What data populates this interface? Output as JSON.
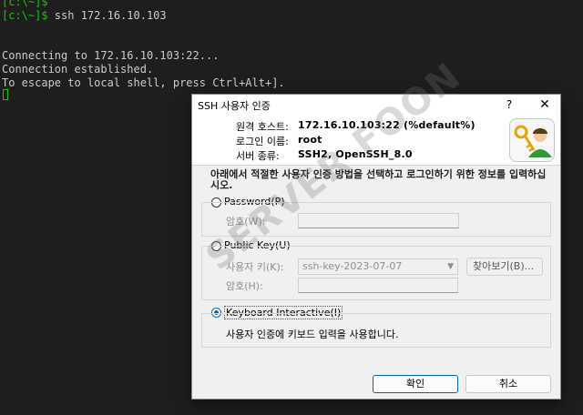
{
  "terminal": {
    "lines": [
      "[c:\\~]$",
      "[c:\\~]$ ssh 172.16.10.103",
      "Connecting to 172.16.10.103:22...",
      "Connection established.",
      "To escape to local shell, press Ctrl+Alt+]."
    ]
  },
  "dialog": {
    "title": "SSH 사용자 인증",
    "help_label": "?",
    "close_label": "✕",
    "info": {
      "host_label": "원격 호스트:",
      "host_value": "172.16.10.103:22 (%default%)",
      "login_label": "로그인 이름:",
      "login_value": "root",
      "server_label": "서버 종류:",
      "server_value": "SSH2, OpenSSH_8.0"
    },
    "description": "아래에서 적절한 사용자 인증 방법을 선택하고 로그인하기 위한 정보를 입력하십시오.",
    "password": {
      "label": "Password(P)",
      "field_label": "암호(W):",
      "value": ""
    },
    "public_key": {
      "label": "Public Key(U)",
      "user_key_label": "사용자 키(K):",
      "user_key_value": "ssh-key-2023-07-07",
      "browse_label": "찾아보기(B)...",
      "passphrase_label": "암호(H):"
    },
    "keyboard": {
      "label": "Keyboard Interactive(I)",
      "help_text": "사용자 인증에 키보드 입력을 사용합니다.",
      "selected": true
    },
    "ok_label": "확인",
    "cancel_label": "취소"
  },
  "watermark": "SERVER FOON",
  "colors": {
    "terminal_bg": "#1e1e1e",
    "prompt_green": "#16c60c",
    "accent": "#0067c0"
  }
}
